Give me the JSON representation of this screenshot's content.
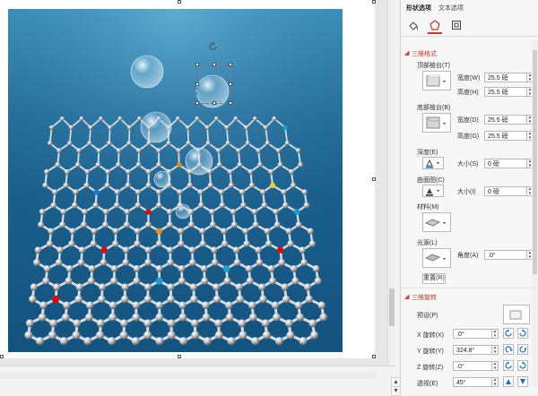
{
  "pane": {
    "tabs": [
      "形状选项",
      "文本选项"
    ],
    "icons": [
      "fill-line-icon",
      "effects-pentagon-icon",
      "size-properties-icon"
    ],
    "accent": "#c0392b",
    "format3d": {
      "title": "三维格式",
      "top_bevel": "顶部棱台(T)",
      "width1_label": "宽度(W)",
      "width1": "25.5 磅",
      "height1_label": "高度(H)",
      "height1": "25.5 磅",
      "bottom_bevel": "底部棱台(B)",
      "width2_label": "宽度(D)",
      "width2": "25.5 磅",
      "height2_label": "高度(G)",
      "height2": "25.5 磅",
      "depth_label": "深度(E)",
      "size1_label": "大小(S)",
      "size1": "0 磅",
      "contour_label": "曲面图(C)",
      "size2_label": "大小(I)",
      "size2": "0 磅",
      "material_label": "材料(M)",
      "lighting_label": "光源(L)",
      "angle_label": "角度(A)",
      "angle": ".0°",
      "reset_label": "重置(R)"
    },
    "rotation3d": {
      "title": "三维旋转",
      "preset_label": "预设(P)",
      "x_label": "X 旋转(X)",
      "x": ".0°",
      "y_label": "Y 旋转(Y)",
      "y": "324.8°",
      "z_label": "Z 旋转(Z)",
      "z": ".0°",
      "persp_label": "透视(E)",
      "persp": "45°"
    }
  }
}
